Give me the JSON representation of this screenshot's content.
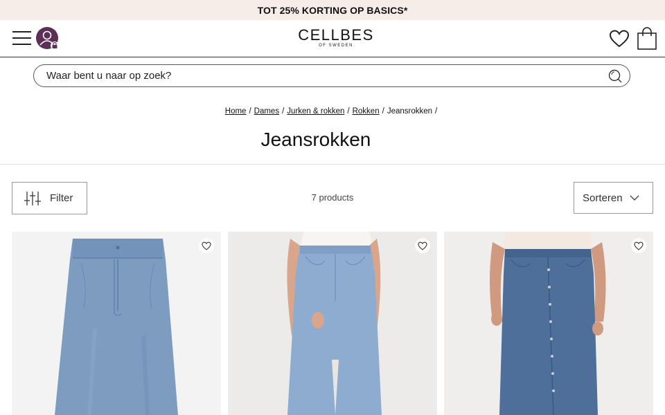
{
  "promo": {
    "text": "TOT 25% KORTING OP BASICS*"
  },
  "header": {
    "logo": "CELLBES",
    "logo_sub": "OF SWEDEN",
    "icons": [
      "menu-icon",
      "user-lock-icon",
      "heart-icon",
      "shopping-bag-icon"
    ]
  },
  "search": {
    "placeholder": "Waar bent u naar op zoek?"
  },
  "breadcrumb": {
    "items": [
      "Home",
      "Dames",
      "Jurken & rokken",
      "Rokken"
    ],
    "current": "Jeansrokken",
    "separator": "/"
  },
  "page": {
    "title": "Jeansrokken"
  },
  "toolbar": {
    "filter_label": "Filter",
    "product_count": "7 products",
    "sort_label": "Sorteren"
  },
  "products": [
    {
      "image": "denim-maxi-skirt-flat",
      "icon": "heart-outline-icon"
    },
    {
      "image": "denim-skirt-front-slit-model",
      "icon": "heart-outline-icon"
    },
    {
      "image": "denim-skirt-button-front-model",
      "icon": "heart-outline-icon"
    }
  ],
  "colors": {
    "promo_bg": "#f6ece8",
    "avatar": "#5b2f56",
    "denim_light": "#7e9cc0",
    "denim_dark": "#4d6f99"
  }
}
